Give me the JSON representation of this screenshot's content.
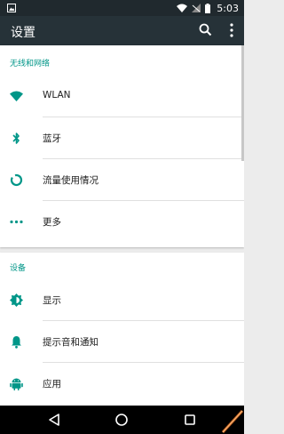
{
  "status_bar": {
    "time": "5:03",
    "icons": [
      "notification-icon",
      "wifi-icon",
      "signal-off-icon",
      "battery-icon"
    ]
  },
  "toolbar": {
    "title": "设置",
    "actions": [
      "search-icon",
      "more-vert-icon"
    ]
  },
  "sections": [
    {
      "header": "无线和网络",
      "items": [
        {
          "label": "WLAN",
          "icon": "wifi-icon"
        },
        {
          "label": "蓝牙",
          "icon": "bluetooth-icon"
        },
        {
          "label": "流量使用情况",
          "icon": "data-usage-icon"
        },
        {
          "label": "更多",
          "icon": "more-horiz-icon"
        }
      ]
    },
    {
      "header": "设备",
      "items": [
        {
          "label": "显示",
          "icon": "brightness-icon"
        },
        {
          "label": "提示音和通知",
          "icon": "bell-icon"
        },
        {
          "label": "应用",
          "icon": "android-icon"
        }
      ]
    }
  ],
  "nav_bar": {
    "buttons": [
      "back-icon",
      "home-icon",
      "recents-icon"
    ]
  },
  "colors": {
    "accent": "#009688",
    "toolbar": "#263238",
    "status_bar": "#20292E",
    "background": "#ECECEC",
    "text_primary": "#212121",
    "divider": "#E0E0E0"
  }
}
